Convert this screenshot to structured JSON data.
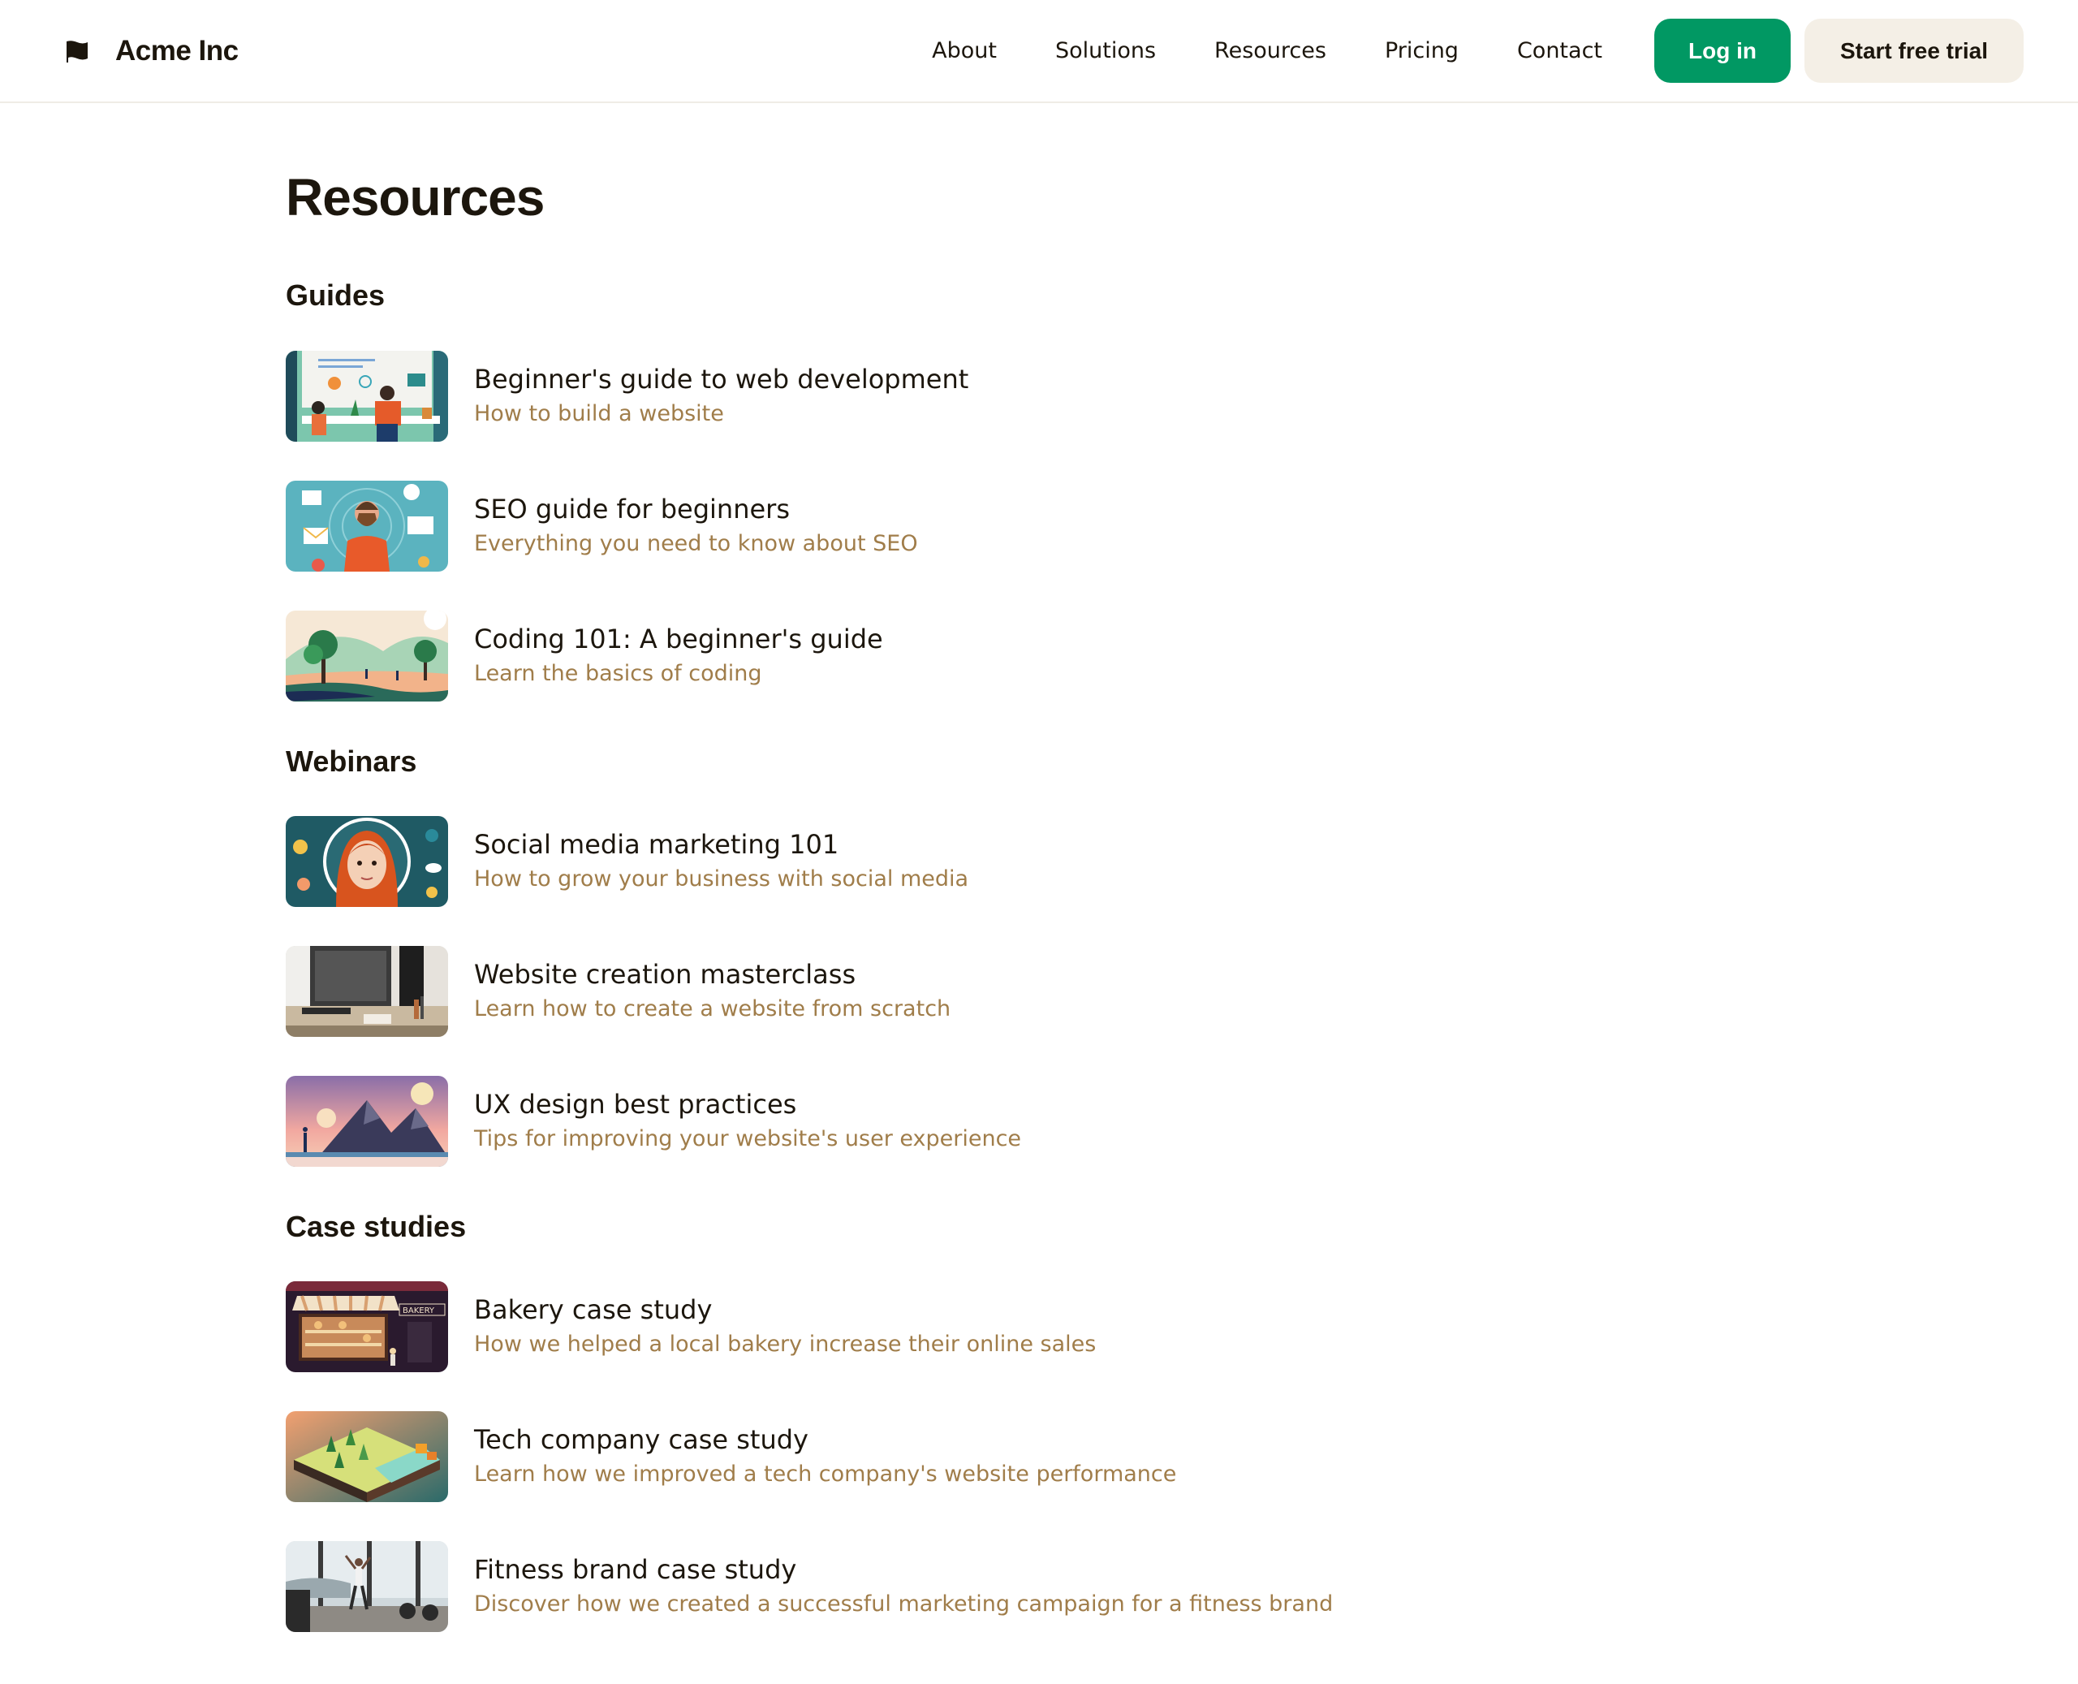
{
  "brand": {
    "name": "Acme Inc",
    "icon": "flag-icon"
  },
  "nav": {
    "links": [
      "About",
      "Solutions",
      "Resources",
      "Pricing",
      "Contact"
    ],
    "login_label": "Log in",
    "trial_label": "Start free trial"
  },
  "colors": {
    "accent": "#019863",
    "secondary_button": "#f4efe6",
    "subtitle": "#a07d4a",
    "text": "#1c160d"
  },
  "page_title": "Resources",
  "sections": [
    {
      "title": "Guides",
      "items": [
        {
          "title": "Beginner's guide to web development",
          "subtitle": "How to build a website",
          "image": "web-development-illustration"
        },
        {
          "title": "SEO guide for beginners",
          "subtitle": "Everything you need to know about SEO",
          "image": "seo-illustration"
        },
        {
          "title": "Coding 101: A beginner's guide",
          "subtitle": "Learn the basics of coding",
          "image": "landscape-illustration"
        }
      ]
    },
    {
      "title": "Webinars",
      "items": [
        {
          "title": "Social media marketing 101",
          "subtitle": "How to grow your business with social media",
          "image": "social-media-illustration"
        },
        {
          "title": "Website creation masterclass",
          "subtitle": "Learn how to create a website from scratch",
          "image": "desk-photo"
        },
        {
          "title": "UX design best practices",
          "subtitle": "Tips for improving your website's user experience",
          "image": "mountain-illustration"
        }
      ]
    },
    {
      "title": "Case studies",
      "items": [
        {
          "title": "Bakery case study",
          "subtitle": "How we helped a local bakery increase their online sales",
          "image": "bakery-illustration"
        },
        {
          "title": "Tech company case study",
          "subtitle": "Learn how we improved a tech company's website performance",
          "image": "isometric-park-illustration"
        },
        {
          "title": "Fitness brand case study",
          "subtitle": "Discover how we created a successful marketing campaign for a fitness brand",
          "image": "gym-photo"
        }
      ]
    }
  ]
}
